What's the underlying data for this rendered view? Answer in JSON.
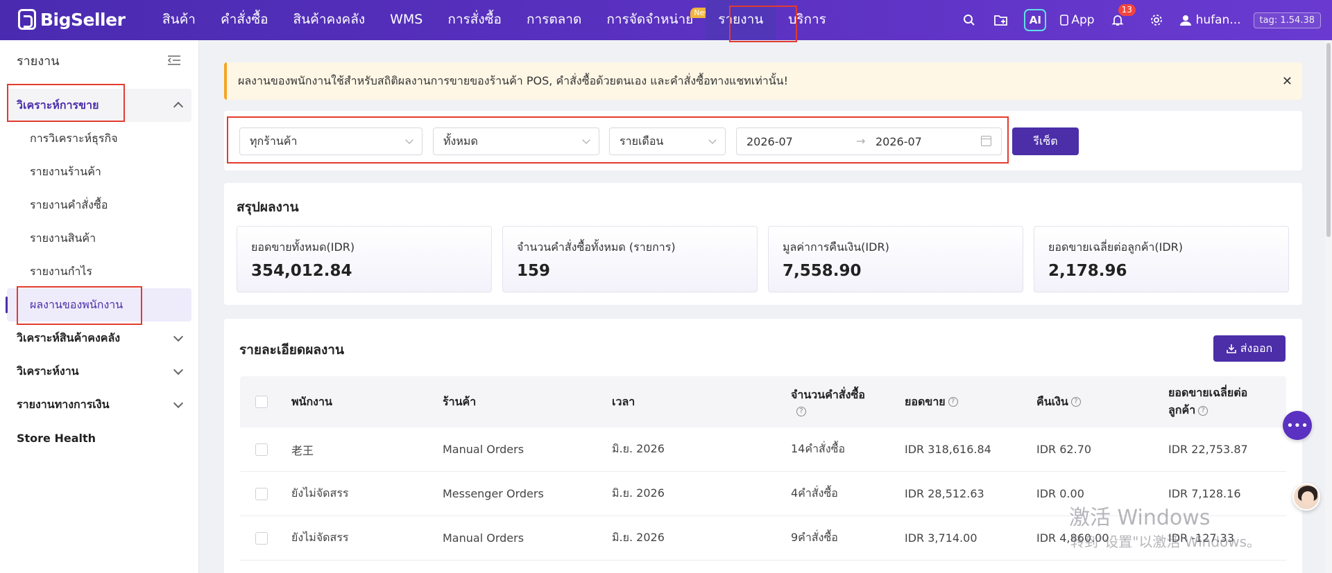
{
  "app": {
    "logo": "BigSeller",
    "version_tag": "tag: 1.54.38",
    "username": "hufan..."
  },
  "nav": {
    "items": [
      {
        "label": "สินค้า"
      },
      {
        "label": "คำสั่งซื้อ"
      },
      {
        "label": "สินค้าคงคลัง"
      },
      {
        "label": "WMS"
      },
      {
        "label": "การสั่งซื้อ"
      },
      {
        "label": "การตลาด"
      },
      {
        "label": "การจัดจำหน่าย",
        "badge": "New"
      },
      {
        "label": "รายงาน",
        "active": true
      },
      {
        "label": "บริการ"
      }
    ],
    "ai_label": "AI",
    "app_label": "App",
    "notification_count": "13"
  },
  "sidebar": {
    "title": "รายงาน",
    "group_sales": "วิเคราะห์การขาย",
    "items": [
      {
        "label": "การวิเคราะห์ธุรกิจ"
      },
      {
        "label": "รายงานร้านค้า"
      },
      {
        "label": "รายงานคำสั่งซื้อ"
      },
      {
        "label": "รายงานสินค้า"
      },
      {
        "label": "รายงานกำไร"
      },
      {
        "label": "ผลงานของพนักงาน",
        "active": true
      }
    ],
    "group_inventory": "วิเคราะห์สินค้าคงคลัง",
    "group_work": "วิเคราะห์งาน",
    "group_finance": "รายงานทางการเงิน",
    "store_health": "Store Health"
  },
  "notice": {
    "text": "ผลงานของพนักงานใช้สำหรับสถิติผลงานการขายของร้านค้า POS, คำสั่งซื้อด้วยตนเอง และคำสั่งซื้อทางแชทเท่านั้น!"
  },
  "filters": {
    "store": "ทุกร้านค้า",
    "status": "ทั้งหมด",
    "period": "รายเดือน",
    "date_from": "2026-07",
    "date_to": "2026-07",
    "reset_label": "รีเซ็ต"
  },
  "summary": {
    "title": "สรุปผลงาน",
    "stats": [
      {
        "label": "ยอดขายทั้งหมด(IDR)",
        "value": "354,012.84"
      },
      {
        "label": "จำนวนคำสั่งซื้อทั้งหมด (รายการ)",
        "value": "159"
      },
      {
        "label": "มูลค่าการคืนเงิน(IDR)",
        "value": "7,558.90"
      },
      {
        "label": "ยอดขายเฉลี่ยต่อลูกค้า(IDR)",
        "value": "2,178.96"
      }
    ]
  },
  "details": {
    "title": "รายละเอียดผลงาน",
    "export_label": "ส่งออก",
    "columns": {
      "employee": "พนักงาน",
      "store": "ร้านค้า",
      "time": "เวลา",
      "orders": "จำนวนคำสั่งซื้อ",
      "sales": "ยอดขาย",
      "refund": "คืนเงิน",
      "avg_line1": "ยอดขายเฉลี่ยต่อ",
      "avg_line2": "ลูกค้า"
    },
    "rows": [
      {
        "employee": "老王",
        "store": "Manual Orders",
        "time": "มิ.ย. 2026",
        "orders": "14คำสั่งซื้อ",
        "sales": "IDR 318,616.84",
        "refund": "IDR 62.70",
        "avg": "IDR 22,753.87"
      },
      {
        "employee": "ยังไม่จัดสรร",
        "store": "Messenger Orders",
        "time": "มิ.ย. 2026",
        "orders": "4คำสั่งซื้อ",
        "sales": "IDR 28,512.63",
        "refund": "IDR 0.00",
        "avg": "IDR 7,128.16"
      },
      {
        "employee": "ยังไม่จัดสรร",
        "store": "Manual Orders",
        "time": "มิ.ย. 2026",
        "orders": "9คำสั่งซื้อ",
        "sales": "IDR 3,714.00",
        "refund": "IDR 4,860.00",
        "avg": "IDR -127.33"
      }
    ]
  },
  "watermark": {
    "line1": "激活 Windows",
    "line2": "转到\"设置\"以激活 Windows。"
  },
  "colors": {
    "brand": "#4b2ea8",
    "highlight": "#e23b2e",
    "notice_bg": "#fff7e6"
  }
}
